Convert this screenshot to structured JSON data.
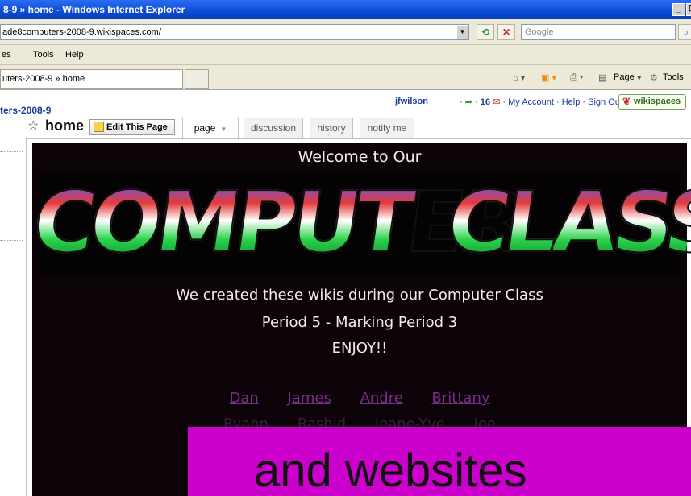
{
  "browser": {
    "title": "8-9 » home - Windows Internet Explorer",
    "address": "ade8computers-2008-9.wikispaces.com/",
    "search_placeholder": "Google",
    "menu": [
      "es",
      "Tools",
      "Help"
    ],
    "tab_label": "uters-2008-9 » home",
    "command_bar": {
      "page_label": "Page",
      "tools_label": "Tools"
    }
  },
  "wiki": {
    "user": "jfwilson",
    "message_count": "16",
    "links": [
      "My Account",
      "Help",
      "Sign Out"
    ],
    "logo_text": "wikispaces",
    "site_name": "ters-2008-9",
    "page_title": "home",
    "edit_button": "Edit This Page",
    "tabs": [
      "page",
      "discussion",
      "history",
      "notify me"
    ]
  },
  "content": {
    "welcome": "Welcome to Our",
    "banner_word1": "COMPUTER",
    "banner_word2": "CLASS",
    "lines": [
      "We created these wikis during our Computer Class",
      "Period 5 - Marking Period 3",
      "ENJOY!!"
    ],
    "students_row1": [
      "Dan",
      "James",
      "Andre",
      "Brittany"
    ],
    "students_row2": [
      "Ryann",
      "Rashid",
      "Jeane-Yve",
      "Joe"
    ]
  },
  "overlay": {
    "text": "and websites"
  },
  "colors": {
    "frame": "#00c853",
    "overlay": "#cc00cc",
    "panel": "#0c0308",
    "link": "#7a2d8f"
  }
}
